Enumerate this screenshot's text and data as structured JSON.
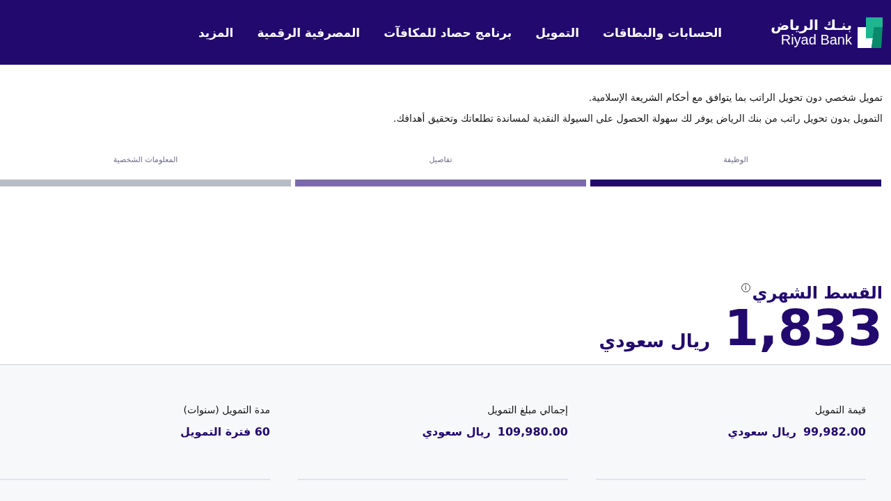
{
  "header": {
    "logo": {
      "arabic": "بنـك الرياض",
      "english": "Riyad Bank"
    },
    "nav": [
      {
        "label": "الحسابات والبطاقات"
      },
      {
        "label": "التمويل"
      },
      {
        "label": "برنامج حصاد للمكافآت"
      },
      {
        "label": "المصرفية الرقمية"
      },
      {
        "label": "المزيد"
      }
    ]
  },
  "intro": [
    "تمويل شخصي دون تحويل الراتب بما يتوافق مع أحكام الشريعة الإسلامية.",
    "التمويل بدون تحويل راتب من بنك الرياض يوفر لك سهولة الحصول على السيولة النقدية لمساندة تطلعاتك وتحقيق أهدافك."
  ],
  "steps": [
    {
      "label": "الوظيفة",
      "completed": true,
      "selected": false
    },
    {
      "label": "تفاصيل",
      "completed": false,
      "selected": true
    },
    {
      "label": "المعلومات الشخصية",
      "completed": false,
      "selected": false
    }
  ],
  "monthly": {
    "title": "القسط الشهري",
    "info_icon": "i",
    "amount": "1,833",
    "currency": "ريال سعودي"
  },
  "summary": [
    {
      "label": "قيمة التمويل",
      "amount": "99,982.00",
      "currency": "ريال سعودي"
    },
    {
      "label": "إجمالي مبلغ التمويل",
      "amount": "109,980.00",
      "currency": "ريال سعودي"
    },
    {
      "label": "مدة التمويل (سنوات)",
      "amount": "60 فترة التمويل"
    }
  ]
}
